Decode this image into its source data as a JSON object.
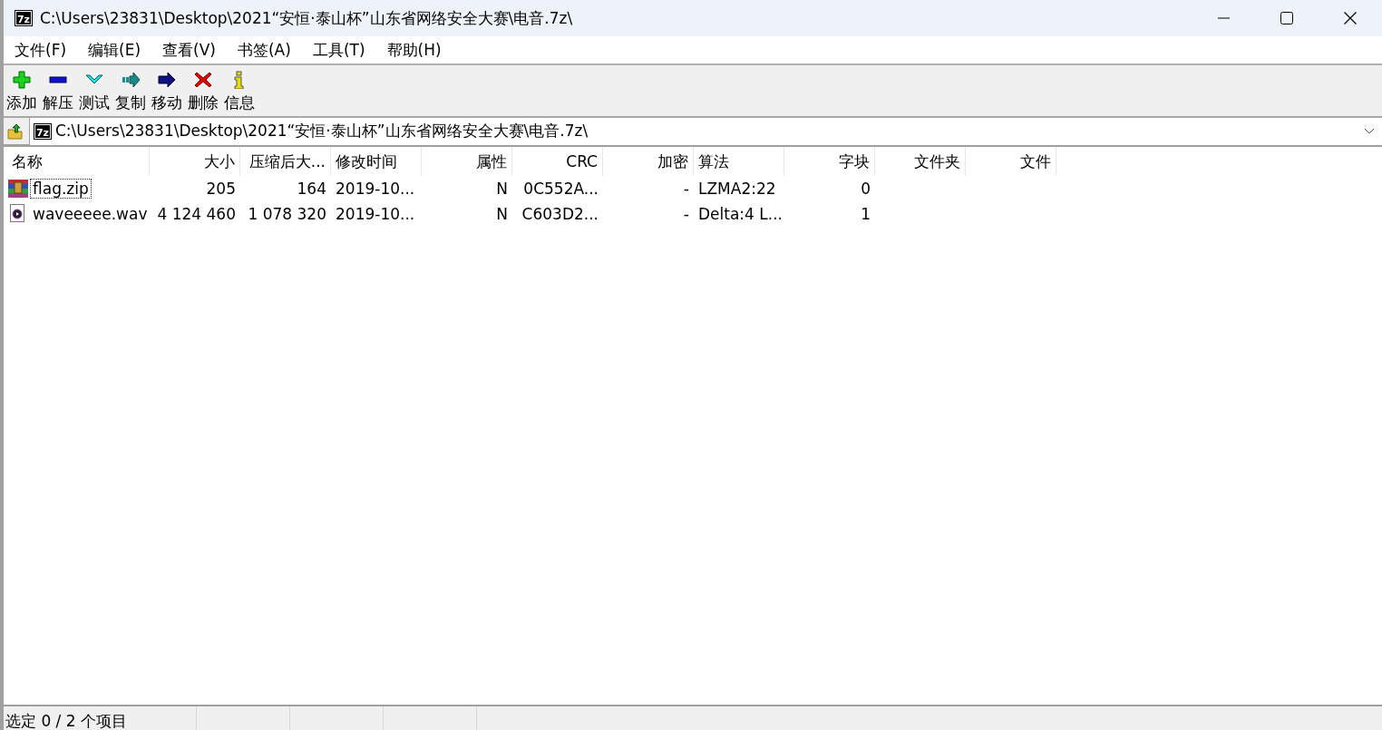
{
  "window": {
    "logo": "7z",
    "title": "C:\\Users\\23831\\Desktop\\2021“安恒·泰山杯”山东省网络安全大赛\\电音.7z\\"
  },
  "menu": [
    "文件(F)",
    "编辑(E)",
    "查看(V)",
    "书签(A)",
    "工具(T)",
    "帮助(H)"
  ],
  "toolbar": [
    {
      "kind": "add",
      "label": "添加"
    },
    {
      "kind": "extract",
      "label": "解压"
    },
    {
      "kind": "test",
      "label": "测试"
    },
    {
      "kind": "copy",
      "label": "复制"
    },
    {
      "kind": "move",
      "label": "移动"
    },
    {
      "kind": "delete",
      "label": "删除"
    },
    {
      "kind": "info",
      "label": "信息"
    }
  ],
  "address": {
    "logo": "7z",
    "value": "C:\\Users\\23831\\Desktop\\2021“安恒·泰山杯”山东省网络安全大赛\\电音.7z\\"
  },
  "table": {
    "columns": [
      "名称",
      "大小",
      "压缩后大...",
      "修改时间",
      "属性",
      "CRC",
      "加密",
      "算法",
      "字块",
      "文件夹",
      "文件"
    ],
    "rows": [
      {
        "kind": "archive",
        "focused": true,
        "cells": [
          "flag.zip",
          "205",
          "164",
          "2019-10...",
          "N",
          "0C552A...",
          "-",
          "LZMA2:22",
          "0"
        ]
      },
      {
        "kind": "audio",
        "focused": false,
        "cells": [
          "waveeeee.wav",
          "4 124 460",
          "1 078 320",
          "2019-10...",
          "N",
          "C603D2...",
          "-",
          "Delta:4 L...",
          "1"
        ]
      }
    ]
  },
  "status_bar": [
    "选定 0 / 2 个项目"
  ]
}
